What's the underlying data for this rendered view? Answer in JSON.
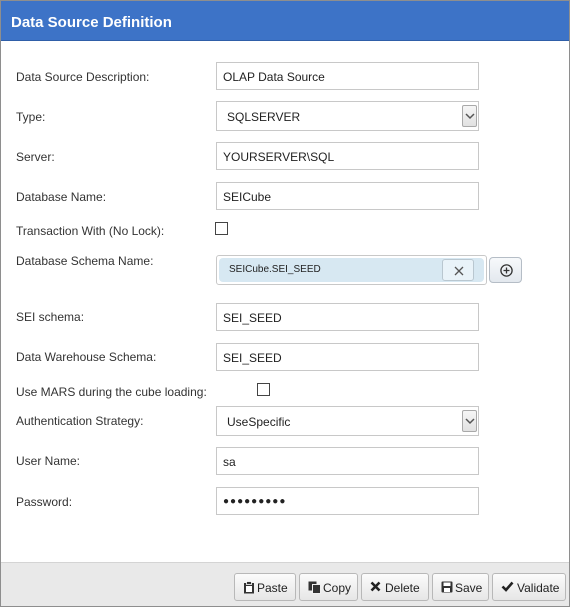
{
  "dialog": {
    "title": "Data Source Definition"
  },
  "form": {
    "description": {
      "label": "Data Source Description:",
      "value": "OLAP Data Source"
    },
    "type": {
      "label": "Type:",
      "value": "SQLSERVER"
    },
    "server": {
      "label": "Server:",
      "value": "YOURSERVER\\SQL"
    },
    "database": {
      "label": "Database Name:",
      "value": "SEICube"
    },
    "nolock": {
      "label": "Transaction With (No Lock):",
      "checked": false
    },
    "schema": {
      "label": "Database Schema Name:",
      "tag": "SEICube.SEI_SEED"
    },
    "sei_schema": {
      "label": "SEI schema:",
      "value": "SEI_SEED"
    },
    "dw_schema": {
      "label": "Data Warehouse Schema:",
      "value": "SEI_SEED"
    },
    "mars": {
      "label": "Use MARS during the cube loading:",
      "checked": false
    },
    "auth": {
      "label": "Authentication Strategy:",
      "value": "UseSpecific"
    },
    "username": {
      "label": "User Name:",
      "value": "sa"
    },
    "password": {
      "label": "Password:",
      "value": "●●●●●●●●●"
    }
  },
  "footer": {
    "paste": "Paste",
    "copy": "Copy",
    "delete": "Delete",
    "save": "Save",
    "validate": "Validate"
  },
  "icons": {
    "chevron": "chevron-down-icon",
    "tag_remove": "close-icon",
    "add": "plus-circle-icon",
    "paste": "clipboard-icon",
    "copy": "copy-icon",
    "delete": "x-icon",
    "save": "floppy-disk-icon",
    "validate": "check-icon"
  },
  "colors": {
    "titlebar": "#3d73c7",
    "tag": "#d7e8f2",
    "footer": "#e9e9e9"
  }
}
